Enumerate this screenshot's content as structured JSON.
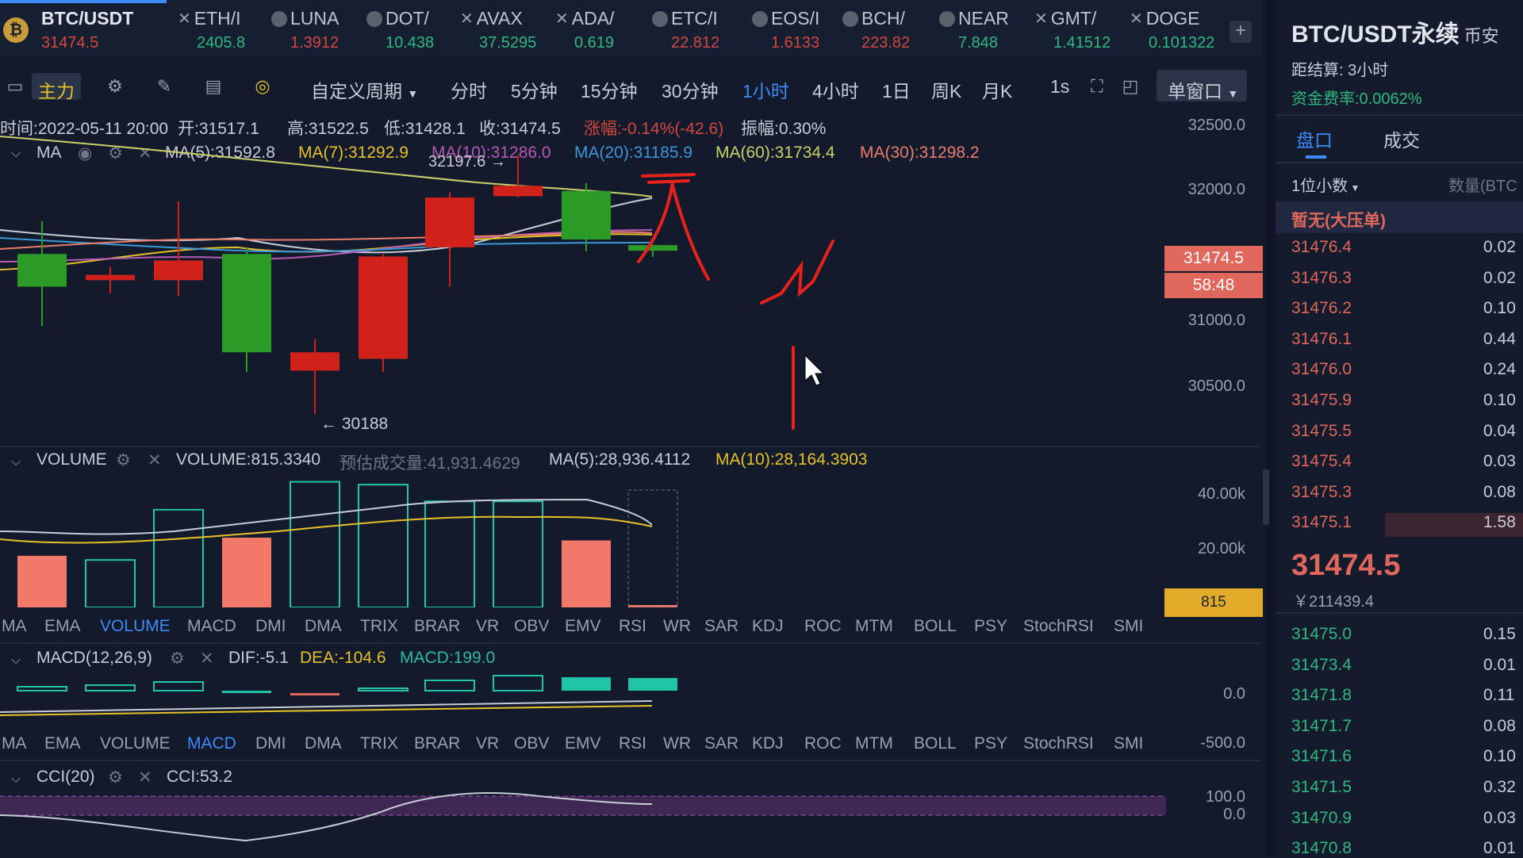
{
  "tickers": [
    {
      "name": "BTC/USDT",
      "price": "31474.5",
      "dir": "down"
    },
    {
      "name": "ETH/I",
      "price": "2405.8",
      "dir": "up"
    },
    {
      "name": "LUNA",
      "price": "1.3912",
      "dir": "down"
    },
    {
      "name": "DOT/",
      "price": "10.438",
      "dir": "up"
    },
    {
      "name": "AVAX",
      "price": "37.5295",
      "dir": "up"
    },
    {
      "name": "ADA/",
      "price": "0.619",
      "dir": "up"
    },
    {
      "name": "ETC/I",
      "price": "22.812",
      "dir": "down"
    },
    {
      "name": "EOS/I",
      "price": "1.6133",
      "dir": "down"
    },
    {
      "name": "BCH/",
      "price": "223.82",
      "dir": "down"
    },
    {
      "name": "NEAR",
      "price": "7.848",
      "dir": "up"
    },
    {
      "name": "GMT/",
      "price": "1.41512",
      "dir": "up"
    },
    {
      "name": "DOGE",
      "price": "0.101322",
      "dir": "up"
    }
  ],
  "toolbar": {
    "main_label": "主力",
    "custom_period": "自定义周期",
    "periods": [
      "分时",
      "5分钟",
      "15分钟",
      "30分钟",
      "1小时",
      "4小时",
      "1日",
      "周K",
      "月K"
    ],
    "active_period": "1小时",
    "interval": "1s",
    "window_mode": "单窗口"
  },
  "candle_info": {
    "time": "时间:2022-05-11 20:00",
    "open": "开:31517.1",
    "high": "高:31522.5",
    "low": "低:31428.1",
    "close": "收:31474.5",
    "change": "涨幅:-0.14%(-42.6)",
    "amplitude": "振幅:0.30%"
  },
  "ma_legend": {
    "title": "MA",
    "items": [
      {
        "text": "MA(5):31592.8",
        "color": "#c7ccd6"
      },
      {
        "text": "MA(7):31292.9",
        "color": "#e6c229"
      },
      {
        "text": "MA(10):31286.0",
        "color": "#b659b3"
      },
      {
        "text": "MA(20):31185.9",
        "color": "#3c98d6"
      },
      {
        "text": "MA(60):31734.4",
        "color": "#c9d16b"
      },
      {
        "text": "MA(30):31298.2",
        "color": "#e97d6d"
      }
    ]
  },
  "price_chart": {
    "y_ticks": [
      "32500.0",
      "32000.0",
      "31000.0",
      "30500.0"
    ],
    "high_label": "32197.6 →",
    "low_label": "← 30188",
    "current_price": "31474.5",
    "countdown": "58:48"
  },
  "volume_legend": {
    "title": "VOLUME",
    "volume": "VOLUME:815.3340",
    "estimated": "预估成交量:41,931.4629",
    "ma5": "MA(5):28,936.4112",
    "ma10": "MA(10):28,164.3903",
    "y_ticks": [
      "40.00k",
      "20.00k"
    ],
    "current": "815"
  },
  "indicator_tabs": [
    "MA",
    "EMA",
    "VOLUME",
    "MACD",
    "DMI",
    "DMA",
    "TRIX",
    "BRAR",
    "VR",
    "OBV",
    "EMV",
    "RSI",
    "WR",
    "SAR",
    "KDJ",
    "ROC",
    "MTM",
    "BOLL",
    "PSY",
    "StochRSI",
    "SMI"
  ],
  "indicator_tabs_active_1": "VOLUME",
  "indicator_tabs_active_2": "MACD",
  "macd_legend": {
    "title": "MACD(12,26,9)",
    "dif": "DIF:-5.1",
    "dea": "DEA:-104.6",
    "macd": "MACD:199.0",
    "y_ticks": [
      "0.0",
      "-500.0"
    ]
  },
  "cci_legend": {
    "title": "CCI(20)",
    "cci": "CCI:53.2",
    "y_ticks": [
      "100.0",
      "0.0"
    ]
  },
  "side_panel": {
    "title": "BTC/USDT永续",
    "title_suffix": "币安",
    "settlement": "距结算: 3小时",
    "funding": "资金费率:0.0062%",
    "tab_book": "盘口",
    "tab_trades": "成交",
    "decimals": "1位小数",
    "qty_header": "数量(BTC",
    "big_order": "暂无(大压单)",
    "asks": [
      {
        "price": "31476.4",
        "qty": "0.02"
      },
      {
        "price": "31476.3",
        "qty": "0.02"
      },
      {
        "price": "31476.2",
        "qty": "0.10"
      },
      {
        "price": "31476.1",
        "qty": "0.44"
      },
      {
        "price": "31476.0",
        "qty": "0.24"
      },
      {
        "price": "31475.9",
        "qty": "0.10"
      },
      {
        "price": "31475.5",
        "qty": "0.04"
      },
      {
        "price": "31475.4",
        "qty": "0.03"
      },
      {
        "price": "31475.3",
        "qty": "0.08"
      },
      {
        "price": "31475.1",
        "qty": "1.58"
      }
    ],
    "last_price": "31474.5",
    "last_price_cny": "￥211439.4",
    "bids": [
      {
        "price": "31475.0",
        "qty": "0.15"
      },
      {
        "price": "31473.4",
        "qty": "0.01"
      },
      {
        "price": "31471.8",
        "qty": "0.11"
      },
      {
        "price": "31471.7",
        "qty": "0.08"
      },
      {
        "price": "31471.6",
        "qty": "0.10"
      },
      {
        "price": "31471.5",
        "qty": "0.32"
      },
      {
        "price": "31470.9",
        "qty": "0.03"
      },
      {
        "price": "31470.8",
        "qty": "0.01"
      }
    ]
  },
  "chart_data": {
    "type": "candlestick",
    "candles": [
      {
        "o": 31200,
        "c": 31450,
        "h": 31700,
        "l": 30900,
        "dir": "up"
      },
      {
        "o": 31290,
        "c": 31250,
        "h": 31350,
        "l": 31150,
        "dir": "down"
      },
      {
        "o": 31400,
        "c": 31250,
        "h": 31850,
        "l": 31130,
        "dir": "down"
      },
      {
        "o": 31450,
        "c": 30700,
        "h": 31500,
        "l": 30550,
        "dir": "up"
      },
      {
        "o": 30700,
        "c": 30560,
        "h": 30800,
        "l": 30230,
        "dir": "down"
      },
      {
        "o": 31430,
        "c": 30650,
        "h": 31450,
        "l": 30550,
        "dir": "down"
      },
      {
        "o": 31880,
        "c": 31500,
        "h": 31920,
        "l": 31200,
        "dir": "down"
      },
      {
        "o": 31970,
        "c": 31890,
        "h": 32200,
        "l": 31880,
        "dir": "down"
      },
      {
        "o": 31560,
        "c": 31930,
        "h": 31990,
        "l": 31470,
        "dir": "up"
      },
      {
        "o": 31517.1,
        "c": 31474.5,
        "h": 31522.5,
        "l": 31428.1,
        "dir": "up"
      }
    ],
    "volumes": [
      {
        "v": 18500,
        "dir": "down"
      },
      {
        "v": 17000,
        "dir": "up"
      },
      {
        "v": 35000,
        "dir": "up"
      },
      {
        "v": 25000,
        "dir": "down"
      },
      {
        "v": 45000,
        "dir": "up"
      },
      {
        "v": 44000,
        "dir": "up"
      },
      {
        "v": 38000,
        "dir": "up"
      },
      {
        "v": 38000,
        "dir": "up"
      },
      {
        "v": 24000,
        "dir": "down"
      },
      {
        "v": 815,
        "dir": "down"
      }
    ],
    "ylim": [
      30000,
      32600
    ],
    "volume_ylim": [
      0,
      50000
    ]
  }
}
